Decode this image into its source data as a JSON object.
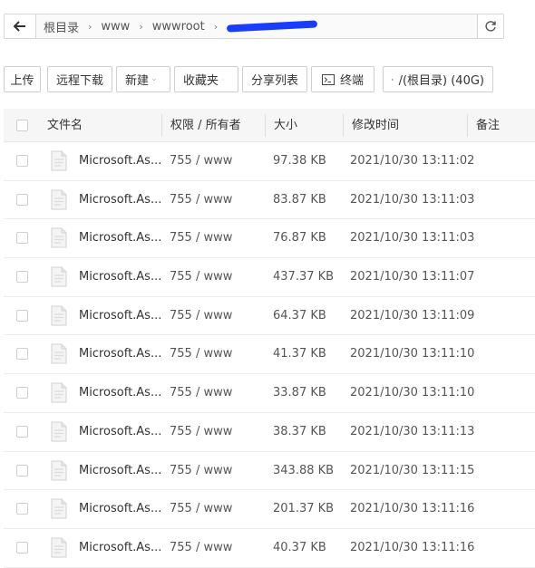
{
  "addressbar": {
    "crumbs": [
      "根目录",
      "www",
      "wwwroot"
    ],
    "separator": "›"
  },
  "toolbar": {
    "upload": "上传",
    "remote_download": "远程下载",
    "new": "新建",
    "favorites": "收藏夹",
    "share_list": "分享列表",
    "terminal": "终端",
    "disk": "/(根目录) (40G)"
  },
  "table": {
    "headers": {
      "name": "文件名",
      "perm": "权限 / 所有者",
      "size": "大小",
      "mtime": "修改时间",
      "note": "备注"
    },
    "rows": [
      {
        "name": "Microsoft.As...",
        "perm": "755 / www",
        "size": "97.38 KB",
        "mtime": "2021/10/30 13:11:02"
      },
      {
        "name": "Microsoft.As...",
        "perm": "755 / www",
        "size": "83.87 KB",
        "mtime": "2021/10/30 13:11:03"
      },
      {
        "name": "Microsoft.As...",
        "perm": "755 / www",
        "size": "76.87 KB",
        "mtime": "2021/10/30 13:11:03"
      },
      {
        "name": "Microsoft.As...",
        "perm": "755 / www",
        "size": "437.37 KB",
        "mtime": "2021/10/30 13:11:07"
      },
      {
        "name": "Microsoft.As...",
        "perm": "755 / www",
        "size": "64.37 KB",
        "mtime": "2021/10/30 13:11:09"
      },
      {
        "name": "Microsoft.As...",
        "perm": "755 / www",
        "size": "41.37 KB",
        "mtime": "2021/10/30 13:11:10"
      },
      {
        "name": "Microsoft.As...",
        "perm": "755 / www",
        "size": "33.87 KB",
        "mtime": "2021/10/30 13:11:10"
      },
      {
        "name": "Microsoft.As...",
        "perm": "755 / www",
        "size": "38.37 KB",
        "mtime": "2021/10/30 13:11:13"
      },
      {
        "name": "Microsoft.As...",
        "perm": "755 / www",
        "size": "343.88 KB",
        "mtime": "2021/10/30 13:11:15"
      },
      {
        "name": "Microsoft.As...",
        "perm": "755 / www",
        "size": "201.37 KB",
        "mtime": "2021/10/30 13:11:16"
      },
      {
        "name": "Microsoft.As...",
        "perm": "755 / www",
        "size": "40.37 KB",
        "mtime": "2021/10/30 13:11:16"
      }
    ]
  },
  "colors": {
    "redaction": "#1a3cff",
    "header_bg": "#f6f6f6"
  }
}
